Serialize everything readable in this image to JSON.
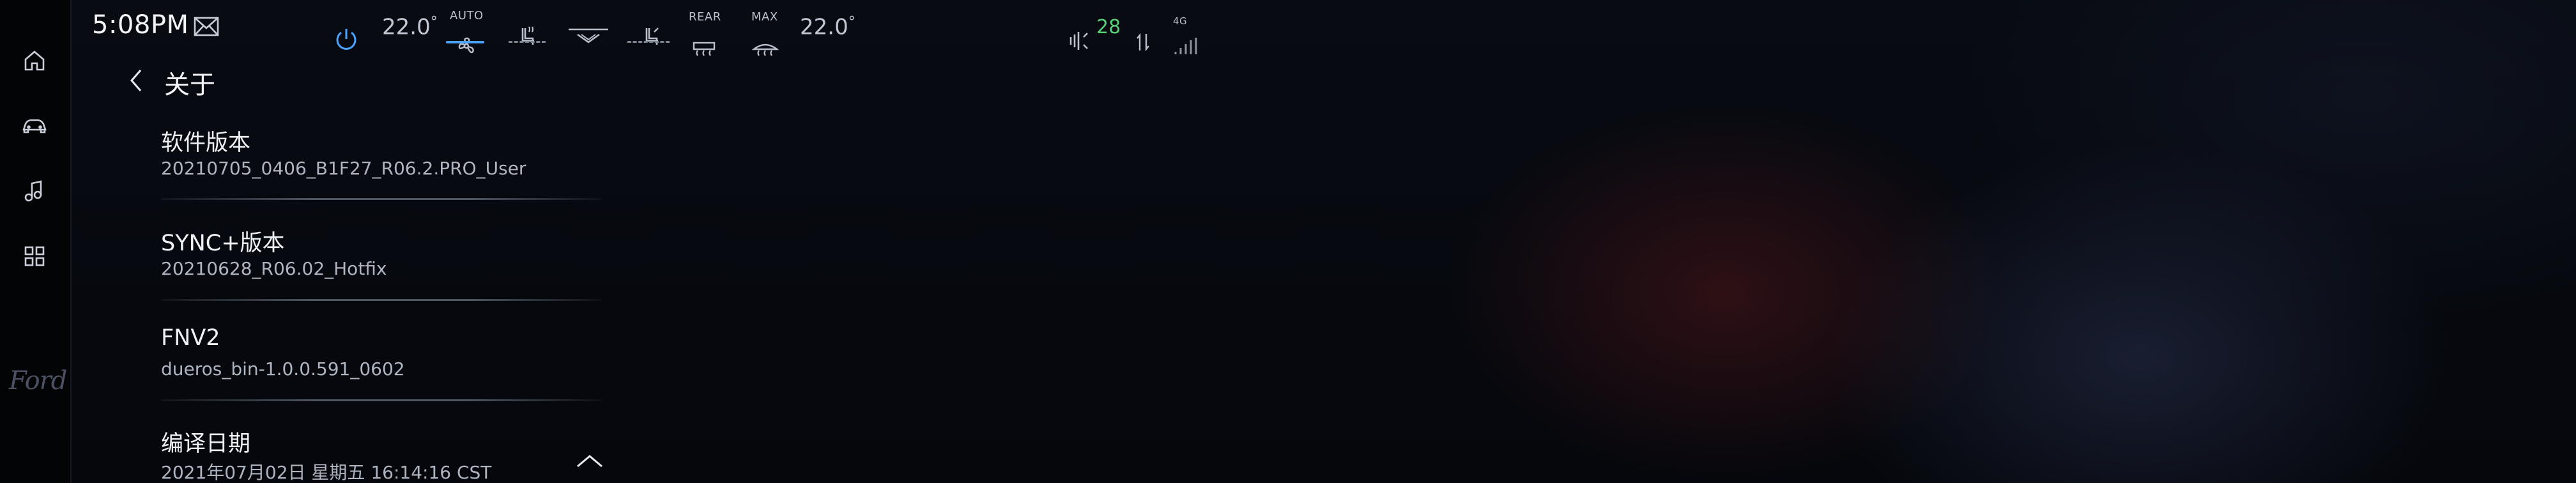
{
  "status_bar": {
    "time": "5:08PM",
    "driver_temp": "22.0",
    "passenger_temp": "22.0",
    "degree": "°",
    "fan_mode_label": "AUTO",
    "rear_defrost_label": "REAR",
    "front_defrost_label": "MAX",
    "signal_strength": "28",
    "network_label": "4G"
  },
  "icons": {
    "home": "home-icon",
    "vehicle": "car-icon",
    "media": "music-note-icon",
    "apps": "apps-grid-icon",
    "brand": "Ford"
  },
  "header": {
    "title": "关于"
  },
  "about_items": [
    {
      "title": "软件版本",
      "value": "20210705_0406_B1F27_R06.2.PRO_User"
    },
    {
      "title": "SYNC+版本",
      "value": "20210628_R06.02_Hotfix"
    },
    {
      "title": "FNV2",
      "value": "dueros_bin-1.0.0.591_0602"
    },
    {
      "title": "编译日期",
      "value": "2021年07月02日  星期五 16:14:16 CST"
    }
  ],
  "colors": {
    "accent": "#4aa3ff",
    "signal": "#58d27a",
    "background": "#06080d"
  }
}
